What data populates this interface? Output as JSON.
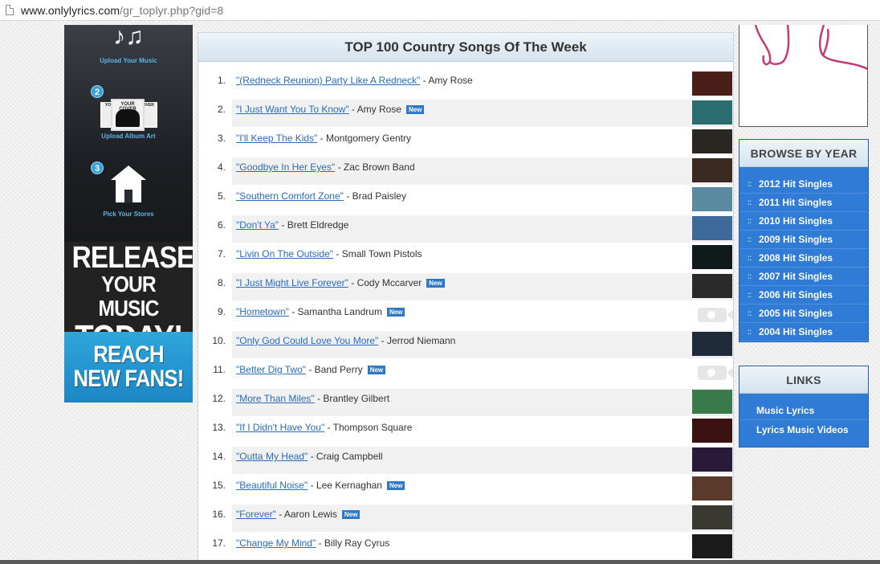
{
  "browser": {
    "url_host": "www.onlylyrics.com",
    "url_path": "/gr_toplyr.php?gid=8"
  },
  "ad": {
    "step1_label": "Upload Your Music",
    "step2_number": "2",
    "step2_label": "Upload Album Art",
    "cover_main": "YOUR COVER",
    "cover_left": "YOUR",
    "cover_right": "COVER",
    "step3_number": "3",
    "step3_label": "Pick Your Stores",
    "release_line1": "RELEASE",
    "release_line2": "YOUR MUSIC",
    "release_line3": "TODAY!",
    "reach_line1": "REACH",
    "reach_line2": "NEW FANS!"
  },
  "main": {
    "title": "TOP 100 Country Songs Of The Week",
    "new_badge": "New",
    "songs": [
      {
        "rank": "1.",
        "title": "\"(Redneck Reunion) Party Like A Redneck\"",
        "artist": " - Amy Rose",
        "is_new": false,
        "thumb_color": "#4a1f1a",
        "has_video": true
      },
      {
        "rank": "2.",
        "title": "\"I Just Want You To Know\"",
        "artist": " - Amy Rose",
        "is_new": true,
        "thumb_color": "#2b6c70",
        "has_video": true
      },
      {
        "rank": "3.",
        "title": "\"I'll Keep The Kids\"",
        "artist": " - Montgomery Gentry",
        "is_new": false,
        "thumb_color": "#2a2622",
        "has_video": true
      },
      {
        "rank": "4.",
        "title": "\"Goodbye In Her Eyes\"",
        "artist": " - Zac Brown Band",
        "is_new": false,
        "thumb_color": "#3a2a22",
        "has_video": true
      },
      {
        "rank": "5.",
        "title": "\"Southern Comfort Zone\"",
        "artist": " - Brad Paisley",
        "is_new": false,
        "thumb_color": "#5a8aa0",
        "has_video": true
      },
      {
        "rank": "6.",
        "title": "\"Don't Ya\"",
        "artist": " - Brett Eldredge",
        "is_new": false,
        "thumb_color": "#3d6a9a",
        "has_video": true
      },
      {
        "rank": "7.",
        "title": "\"Livin On The Outside\"",
        "artist": " - Small Town Pistols",
        "is_new": false,
        "thumb_color": "#101a1a",
        "has_video": true
      },
      {
        "rank": "8.",
        "title": "\"I Just Might Live Forever\"",
        "artist": " - Cody Mccarver",
        "is_new": true,
        "thumb_color": "#2a2a2a",
        "has_video": true
      },
      {
        "rank": "9.",
        "title": "\"Hometown\"",
        "artist": " - Samantha Landrum",
        "is_new": true,
        "thumb_color": "#ffffff",
        "has_video": false
      },
      {
        "rank": "10.",
        "title": "\"Only God Could Love You More\"",
        "artist": " - Jerrod Niemann",
        "is_new": false,
        "thumb_color": "#1e2a3a",
        "has_video": true
      },
      {
        "rank": "11.",
        "title": "\"Better Dig Two\"",
        "artist": " - Band Perry",
        "is_new": true,
        "thumb_color": "#ffffff",
        "has_video": false
      },
      {
        "rank": "12.",
        "title": "\"More Than Miles\"",
        "artist": " - Brantley Gilbert",
        "is_new": false,
        "thumb_color": "#3a7a4a",
        "has_video": true
      },
      {
        "rank": "13.",
        "title": "\"If I Didn't Have You\"",
        "artist": " - Thompson Square",
        "is_new": false,
        "thumb_color": "#3a1212",
        "has_video": true
      },
      {
        "rank": "14.",
        "title": "\"Outta My Head\"",
        "artist": " - Craig Campbell",
        "is_new": false,
        "thumb_color": "#2a1a3a",
        "has_video": true
      },
      {
        "rank": "15.",
        "title": "\"Beautiful Noise\"",
        "artist": " - Lee Kernaghan",
        "is_new": true,
        "thumb_color": "#5a3a2a",
        "has_video": true
      },
      {
        "rank": "16.",
        "title": "\"Forever\"",
        "artist": " - Aaron Lewis",
        "is_new": true,
        "thumb_color": "#3a3a32",
        "has_video": true
      },
      {
        "rank": "17.",
        "title": "\"Change My Mind\"",
        "artist": " - Billy Ray Cyrus",
        "is_new": false,
        "thumb_color": "#1a1a1a",
        "has_video": true
      }
    ]
  },
  "sidebar": {
    "browse_title": "BROWSE BY YEAR",
    "dots": "::",
    "years": [
      "2012 Hit Singles",
      "2011 Hit Singles",
      "2010 Hit Singles",
      "2009 Hit Singles",
      "2008 Hit Singles",
      "2007 Hit Singles",
      "2006 Hit Singles",
      "2005 Hit Singles",
      "2004 Hit Singles"
    ],
    "links_title": "LINKS",
    "links": [
      "Music Lyrics",
      "Lyrics Music Videos"
    ],
    "accent_color": "#2f7bd6"
  }
}
